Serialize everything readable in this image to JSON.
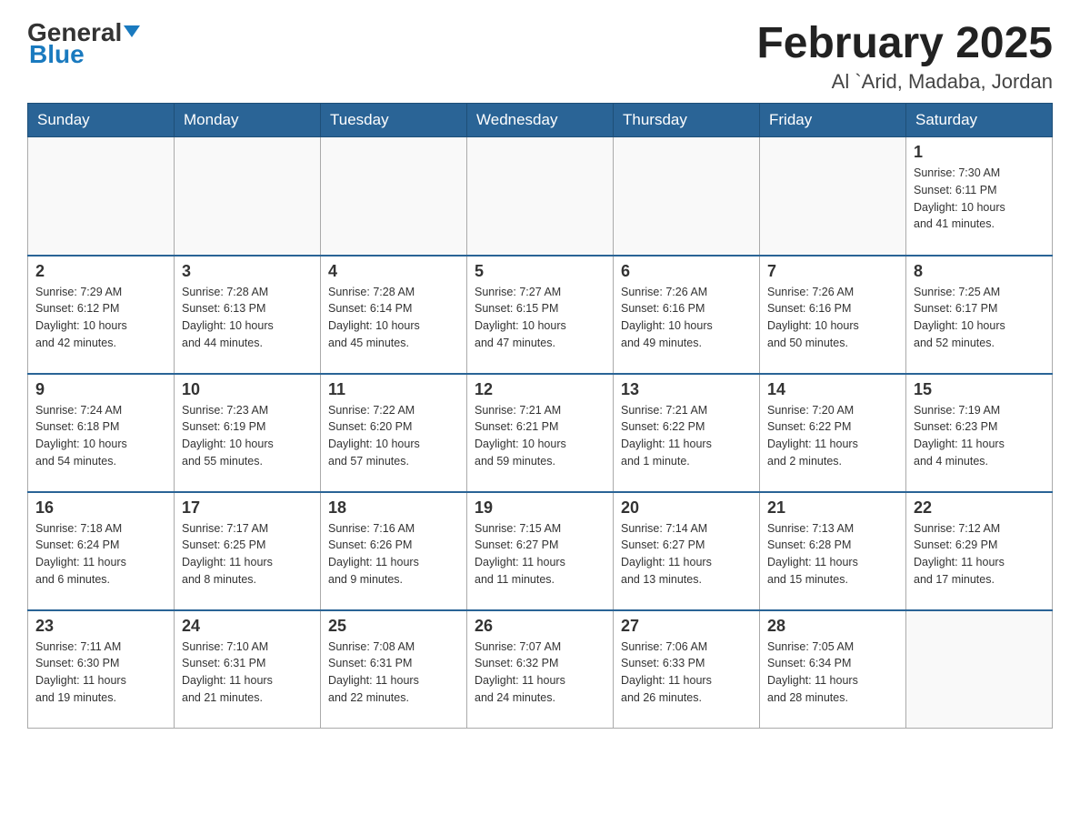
{
  "header": {
    "logo_general": "General",
    "logo_blue": "Blue",
    "month_title": "February 2025",
    "location": "Al `Arid, Madaba, Jordan"
  },
  "weekdays": [
    "Sunday",
    "Monday",
    "Tuesday",
    "Wednesday",
    "Thursday",
    "Friday",
    "Saturday"
  ],
  "weeks": [
    [
      {
        "day": "",
        "info": ""
      },
      {
        "day": "",
        "info": ""
      },
      {
        "day": "",
        "info": ""
      },
      {
        "day": "",
        "info": ""
      },
      {
        "day": "",
        "info": ""
      },
      {
        "day": "",
        "info": ""
      },
      {
        "day": "1",
        "info": "Sunrise: 7:30 AM\nSunset: 6:11 PM\nDaylight: 10 hours\nand 41 minutes."
      }
    ],
    [
      {
        "day": "2",
        "info": "Sunrise: 7:29 AM\nSunset: 6:12 PM\nDaylight: 10 hours\nand 42 minutes."
      },
      {
        "day": "3",
        "info": "Sunrise: 7:28 AM\nSunset: 6:13 PM\nDaylight: 10 hours\nand 44 minutes."
      },
      {
        "day": "4",
        "info": "Sunrise: 7:28 AM\nSunset: 6:14 PM\nDaylight: 10 hours\nand 45 minutes."
      },
      {
        "day": "5",
        "info": "Sunrise: 7:27 AM\nSunset: 6:15 PM\nDaylight: 10 hours\nand 47 minutes."
      },
      {
        "day": "6",
        "info": "Sunrise: 7:26 AM\nSunset: 6:16 PM\nDaylight: 10 hours\nand 49 minutes."
      },
      {
        "day": "7",
        "info": "Sunrise: 7:26 AM\nSunset: 6:16 PM\nDaylight: 10 hours\nand 50 minutes."
      },
      {
        "day": "8",
        "info": "Sunrise: 7:25 AM\nSunset: 6:17 PM\nDaylight: 10 hours\nand 52 minutes."
      }
    ],
    [
      {
        "day": "9",
        "info": "Sunrise: 7:24 AM\nSunset: 6:18 PM\nDaylight: 10 hours\nand 54 minutes."
      },
      {
        "day": "10",
        "info": "Sunrise: 7:23 AM\nSunset: 6:19 PM\nDaylight: 10 hours\nand 55 minutes."
      },
      {
        "day": "11",
        "info": "Sunrise: 7:22 AM\nSunset: 6:20 PM\nDaylight: 10 hours\nand 57 minutes."
      },
      {
        "day": "12",
        "info": "Sunrise: 7:21 AM\nSunset: 6:21 PM\nDaylight: 10 hours\nand 59 minutes."
      },
      {
        "day": "13",
        "info": "Sunrise: 7:21 AM\nSunset: 6:22 PM\nDaylight: 11 hours\nand 1 minute."
      },
      {
        "day": "14",
        "info": "Sunrise: 7:20 AM\nSunset: 6:22 PM\nDaylight: 11 hours\nand 2 minutes."
      },
      {
        "day": "15",
        "info": "Sunrise: 7:19 AM\nSunset: 6:23 PM\nDaylight: 11 hours\nand 4 minutes."
      }
    ],
    [
      {
        "day": "16",
        "info": "Sunrise: 7:18 AM\nSunset: 6:24 PM\nDaylight: 11 hours\nand 6 minutes."
      },
      {
        "day": "17",
        "info": "Sunrise: 7:17 AM\nSunset: 6:25 PM\nDaylight: 11 hours\nand 8 minutes."
      },
      {
        "day": "18",
        "info": "Sunrise: 7:16 AM\nSunset: 6:26 PM\nDaylight: 11 hours\nand 9 minutes."
      },
      {
        "day": "19",
        "info": "Sunrise: 7:15 AM\nSunset: 6:27 PM\nDaylight: 11 hours\nand 11 minutes."
      },
      {
        "day": "20",
        "info": "Sunrise: 7:14 AM\nSunset: 6:27 PM\nDaylight: 11 hours\nand 13 minutes."
      },
      {
        "day": "21",
        "info": "Sunrise: 7:13 AM\nSunset: 6:28 PM\nDaylight: 11 hours\nand 15 minutes."
      },
      {
        "day": "22",
        "info": "Sunrise: 7:12 AM\nSunset: 6:29 PM\nDaylight: 11 hours\nand 17 minutes."
      }
    ],
    [
      {
        "day": "23",
        "info": "Sunrise: 7:11 AM\nSunset: 6:30 PM\nDaylight: 11 hours\nand 19 minutes."
      },
      {
        "day": "24",
        "info": "Sunrise: 7:10 AM\nSunset: 6:31 PM\nDaylight: 11 hours\nand 21 minutes."
      },
      {
        "day": "25",
        "info": "Sunrise: 7:08 AM\nSunset: 6:31 PM\nDaylight: 11 hours\nand 22 minutes."
      },
      {
        "day": "26",
        "info": "Sunrise: 7:07 AM\nSunset: 6:32 PM\nDaylight: 11 hours\nand 24 minutes."
      },
      {
        "day": "27",
        "info": "Sunrise: 7:06 AM\nSunset: 6:33 PM\nDaylight: 11 hours\nand 26 minutes."
      },
      {
        "day": "28",
        "info": "Sunrise: 7:05 AM\nSunset: 6:34 PM\nDaylight: 11 hours\nand 28 minutes."
      },
      {
        "day": "",
        "info": ""
      }
    ]
  ]
}
